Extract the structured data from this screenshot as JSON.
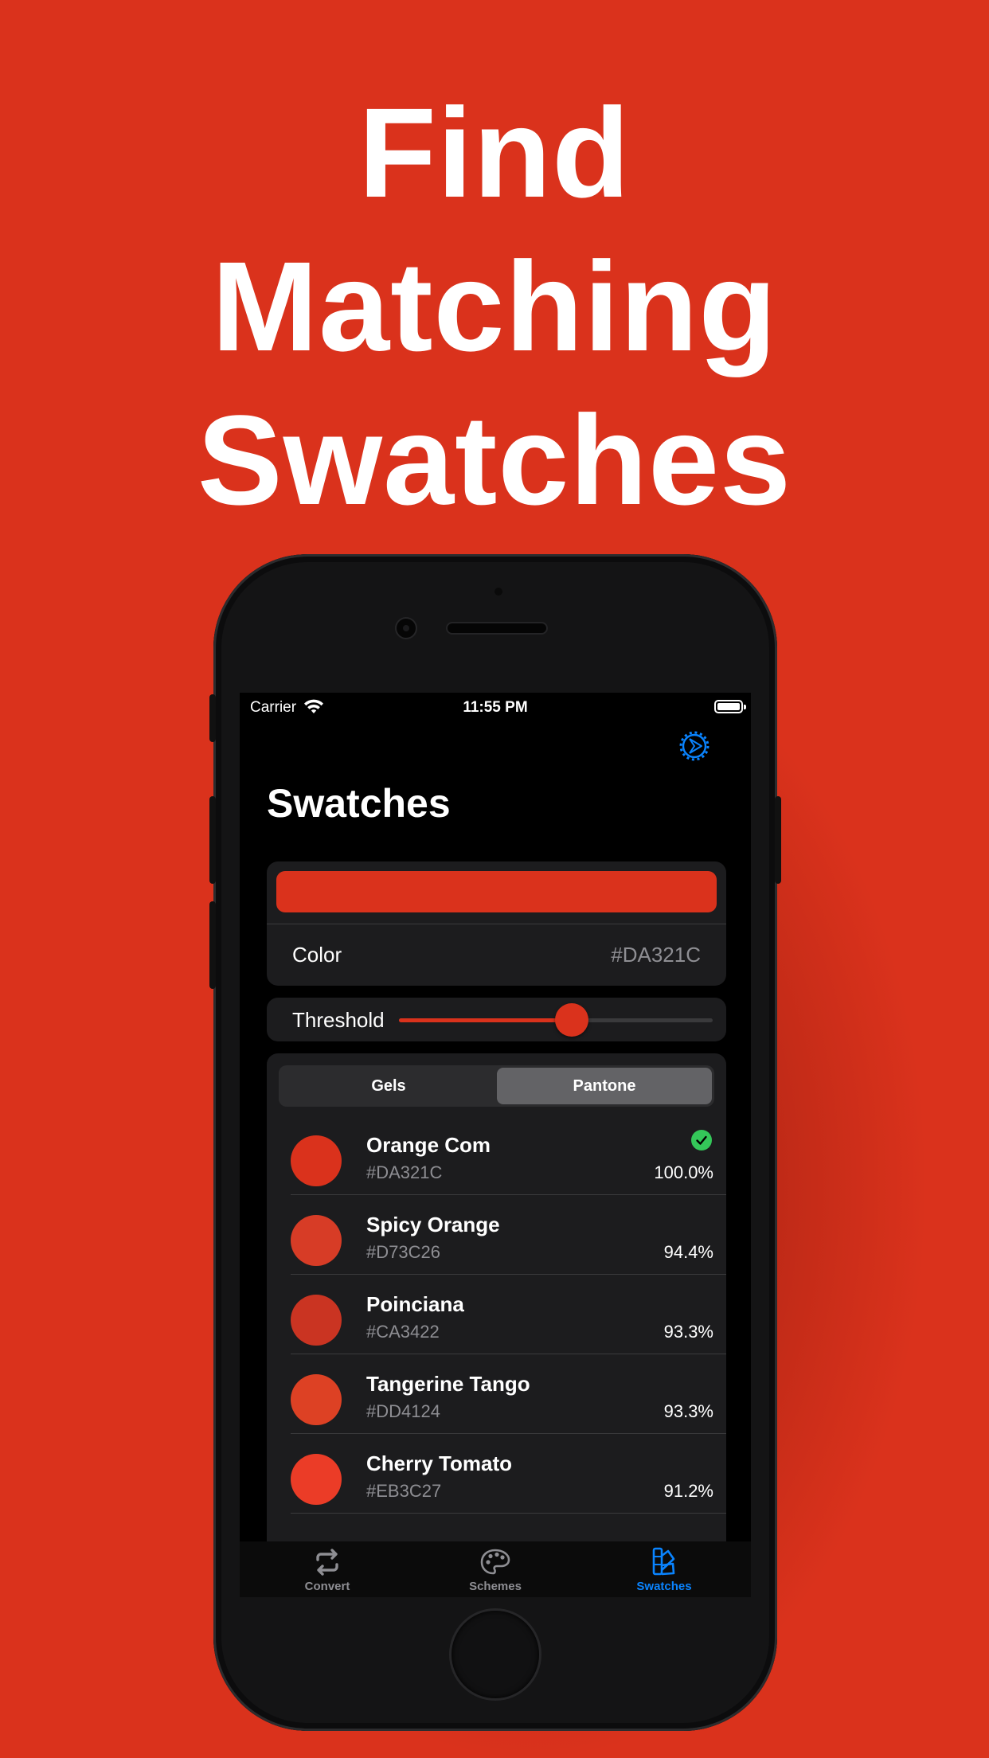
{
  "headline": {
    "line1": "Find",
    "line2": "Matching",
    "line3": "Swatches"
  },
  "status_bar": {
    "carrier": "Carrier",
    "time": "11:55 PM"
  },
  "page": {
    "title": "Swatches"
  },
  "color_card": {
    "label": "Color",
    "value": "#DA321C",
    "swatch_color": "#DA321C"
  },
  "threshold": {
    "label": "Threshold",
    "level_fraction": 0.55
  },
  "segmented_control": {
    "options": [
      "Gels",
      "Pantone"
    ],
    "selected": "Pantone"
  },
  "swatches": [
    {
      "name": "Orange Com",
      "hex": "#DA321C",
      "match": "100.0%",
      "color": "#DA321C",
      "checked": true
    },
    {
      "name": "Spicy Orange",
      "hex": "#D73C26",
      "match": "94.4%",
      "color": "#D73C26",
      "checked": false
    },
    {
      "name": "Poinciana",
      "hex": "#CA3422",
      "match": "93.3%",
      "color": "#CA3422",
      "checked": false
    },
    {
      "name": "Tangerine Tango",
      "hex": "#DD4124",
      "match": "93.3%",
      "color": "#DD4124",
      "checked": false
    },
    {
      "name": "Cherry Tomato",
      "hex": "#EB3C27",
      "match": "91.2%",
      "color": "#EB3C27",
      "checked": false
    }
  ],
  "tab_bar": {
    "tabs": [
      {
        "label": "Convert",
        "icon": "repeat-arrows-icon"
      },
      {
        "label": "Schemes",
        "icon": "palette-icon"
      },
      {
        "label": "Swatches",
        "icon": "swatchbook-icon"
      }
    ],
    "selected": "Swatches",
    "accent": "#0A84FF"
  },
  "colors": {
    "background": "#DA321C",
    "accent": "#0A84FF",
    "check": "#34C759"
  }
}
